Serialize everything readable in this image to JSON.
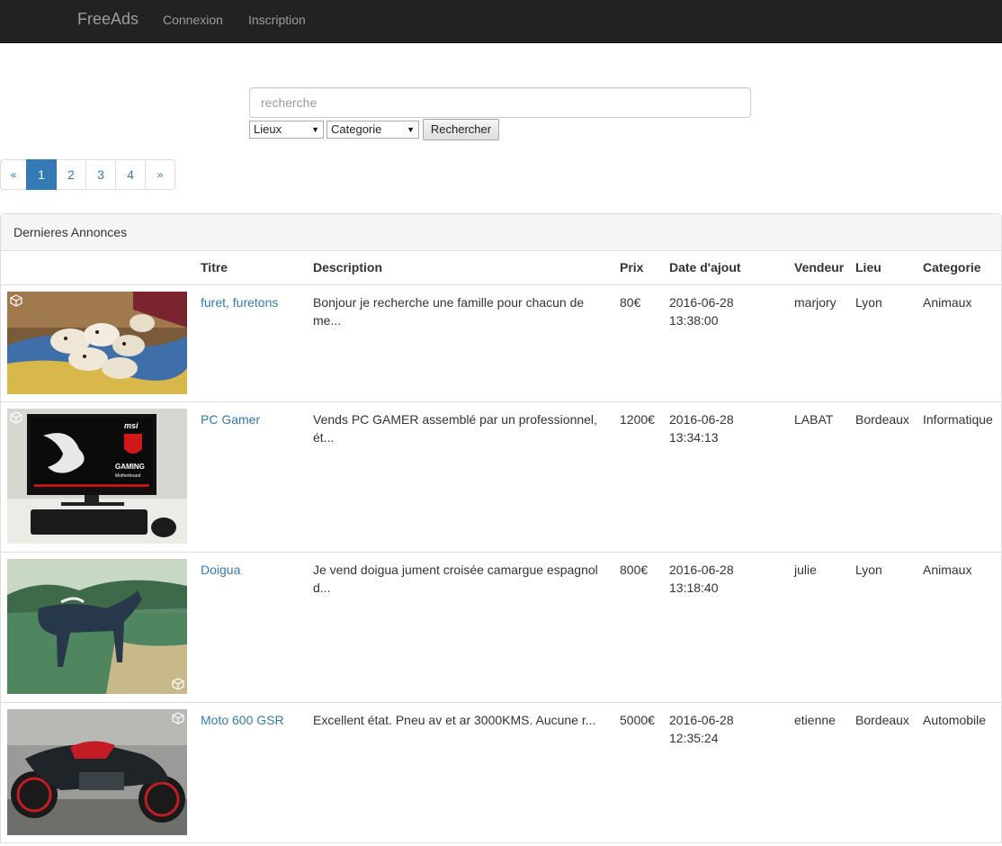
{
  "navbar": {
    "brand": "FreeAds",
    "links": [
      "Connexion",
      "Inscription"
    ]
  },
  "search": {
    "placeholder": "recherche",
    "lieux_selected": "Lieux",
    "categorie_selected": "Categorie",
    "button_label": "Rechercher"
  },
  "pagination": {
    "prev": "«",
    "pages": [
      "1",
      "2",
      "3",
      "4"
    ],
    "next": "»",
    "active": "1"
  },
  "panel": {
    "title": "Dernieres Annonces",
    "columns": [
      "",
      "Titre",
      "Description",
      "Prix",
      "Date d'ajout",
      "Vendeur",
      "Lieu",
      "Categorie"
    ]
  },
  "ads": [
    {
      "title": "furet, furetons",
      "description_line1": "Bonjour je recherche une famille pour chacun de",
      "description_line2": "me...",
      "price": "80€",
      "date": "2016-06-28",
      "time": "13:38:00",
      "seller": "marjory",
      "place": "Lyon",
      "category": "Animaux",
      "image": "ferrets-photo"
    },
    {
      "title": "PC Gamer",
      "description_line1": "Vends PC GAMER assemblé par un professionnel,",
      "description_line2": "ét...",
      "price": "1200€",
      "date": "2016-06-28",
      "time": "13:34:13",
      "seller": "LABAT",
      "place": "Bordeaux",
      "category": "Informatique",
      "image": "gaming-pc-photo",
      "image_text_brand": "msi",
      "image_text_gaming": "GAMING",
      "image_text_board": "Motherboard"
    },
    {
      "title": "Doigua",
      "description_line1": "Je vend doigua jument croisée camargue espagnol",
      "description_line2": "d...",
      "price": "800€",
      "date": "2016-06-28",
      "time": "13:18:40",
      "seller": "julie",
      "place": "Lyon",
      "category": "Animaux",
      "image": "horse-photo"
    },
    {
      "title": "Moto 600 GSR",
      "description_line1": "Excellent état. Pneu av et ar 3000KMS. Aucune r...",
      "description_line2": "",
      "price": "5000€",
      "date": "2016-06-28",
      "time": "12:35:24",
      "seller": "etienne",
      "place": "Bordeaux",
      "category": "Automobile",
      "image": "motorcycle-photo"
    }
  ],
  "colors": {
    "navbar_bg": "#222222",
    "navbar_text": "#9d9d9d",
    "link": "#337ab7",
    "active_page": "#337ab7",
    "panel_heading_bg": "#f5f5f5",
    "border": "#dddddd"
  }
}
